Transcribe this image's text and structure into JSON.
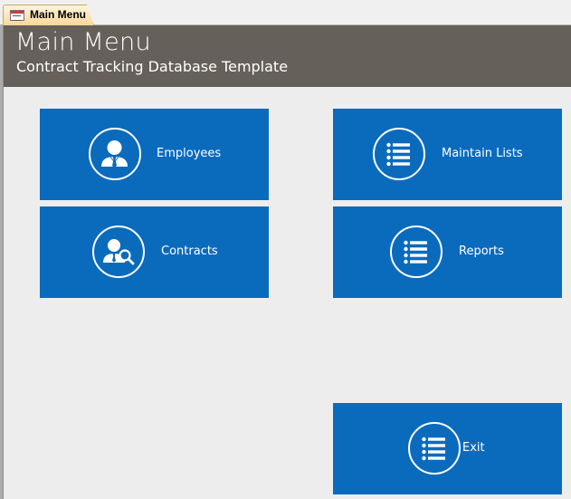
{
  "tab": {
    "label": "Main Menu",
    "icon": "form-icon"
  },
  "header": {
    "title": "Main Menu",
    "subtitle": "Contract Tracking Database Template",
    "background": "#66605a"
  },
  "tiles": {
    "employees": {
      "label": "Employees",
      "icon": "person-icon"
    },
    "maintain_lists": {
      "label": "Maintain Lists",
      "icon": "list-icon"
    },
    "contracts": {
      "label": "Contracts",
      "icon": "person-search-icon"
    },
    "reports": {
      "label": "Reports",
      "icon": "list-icon"
    },
    "exit": {
      "label": "Exit",
      "icon": "list-icon"
    }
  },
  "colors": {
    "tile": "#0a6bbd",
    "form_background": "#ededed",
    "tab_highlight": "#f9d79a"
  }
}
